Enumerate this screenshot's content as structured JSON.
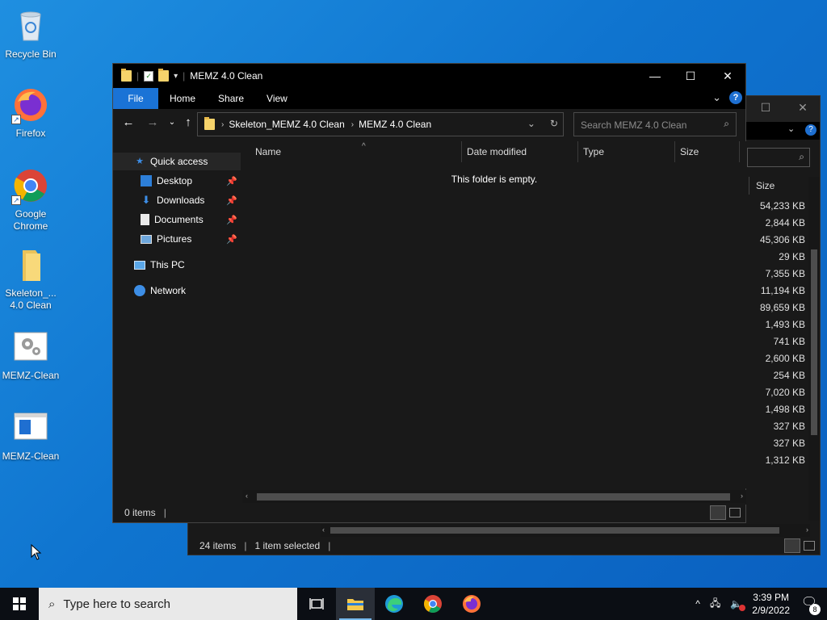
{
  "desktop": {
    "icons": [
      {
        "label": "Recycle Bin",
        "icon": "recycle-bin-icon"
      },
      {
        "label": "Firefox",
        "icon": "firefox-icon"
      },
      {
        "label": "Google Chrome",
        "icon": "chrome-icon"
      },
      {
        "label": "Skeleton_... 4.0 Clean",
        "icon": "folder-icon"
      },
      {
        "label": "MEMZ-Clean",
        "icon": "settings-icon"
      },
      {
        "label": "MEMZ-Clean",
        "icon": "window-icon"
      }
    ]
  },
  "back_window": {
    "column_header": "Size",
    "sizes": [
      "54,233 KB",
      "2,844 KB",
      "45,306 KB",
      "29 KB",
      "7,355 KB",
      "11,194 KB",
      "89,659 KB",
      "1,493 KB",
      "741 KB",
      "2,600 KB",
      "254 KB",
      "7,020 KB",
      "1,498 KB",
      "327 KB",
      "327 KB",
      "1,312 KB"
    ],
    "status": {
      "items_count": "24 items",
      "selection": "1 item selected",
      "sep": "|"
    }
  },
  "window": {
    "title": "MEMZ 4.0 Clean",
    "controls": {
      "minimize": "—",
      "maximize": "☐",
      "close": "✕"
    },
    "ribbon": {
      "tabs": [
        "File",
        "Home",
        "Share",
        "View"
      ]
    },
    "breadcrumb": [
      "Skeleton_MEMZ 4.0 Clean",
      "MEMZ 4.0 Clean"
    ],
    "search_placeholder": "Search MEMZ 4.0 Clean",
    "nav_pane": {
      "quick_access": "Quick access",
      "pinned": [
        "Desktop",
        "Downloads",
        "Documents",
        "Pictures"
      ],
      "this_pc": "This PC",
      "network": "Network"
    },
    "columns": [
      "Name",
      "Date modified",
      "Type",
      "Size"
    ],
    "empty_message": "This folder is empty.",
    "status": {
      "items_count": "0 items",
      "sep": "|"
    }
  },
  "taskbar": {
    "search_placeholder": "Type here to search",
    "apps": [
      "task-view-icon",
      "file-explorer-icon",
      "edge-icon",
      "chrome-icon",
      "firefox-icon"
    ],
    "clock": {
      "time": "3:39 PM",
      "date": "2/9/2022"
    },
    "notification_count": "8"
  },
  "colors": {
    "accent": "#1a73d6",
    "desktop": "#0f74cf",
    "window_bg": "#191919"
  }
}
